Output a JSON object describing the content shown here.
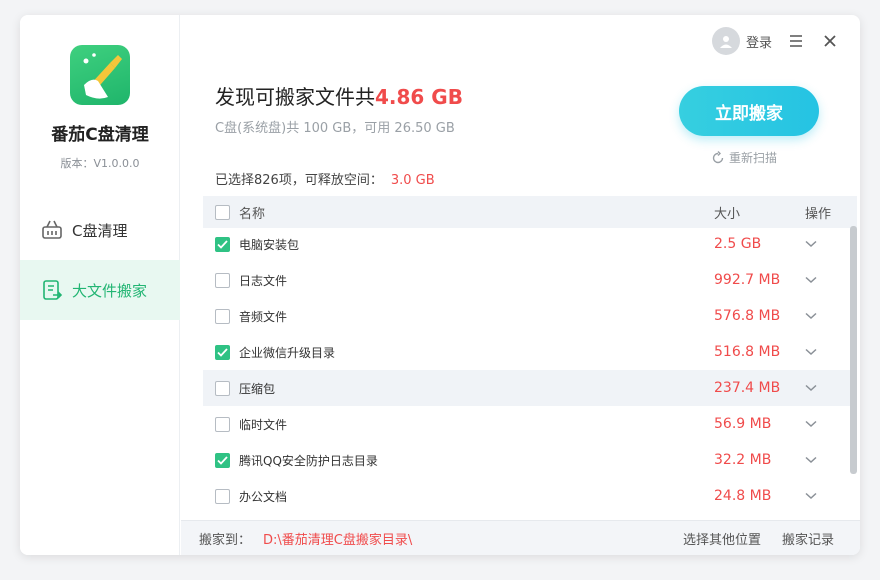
{
  "app": {
    "name": "番茄C盘清理",
    "version": "版本：V1.0.0.0"
  },
  "sidebar": {
    "items": [
      {
        "label": "C盘清理",
        "icon": "basket-icon"
      },
      {
        "label": "大文件搬家",
        "icon": "file-move-icon"
      }
    ]
  },
  "topbar": {
    "login": "登录"
  },
  "summary": {
    "title_prefix": "发现可搬家文件共",
    "total_size": "4.86 GB",
    "disk_info": "C盘(系统盘)共 100 GB，可用 26.50 GB",
    "selected_text": "已选择826项，可释放空间：",
    "selected_size": "3.0 GB"
  },
  "actions": {
    "move_now": "立即搬家",
    "rescan": "重新扫描"
  },
  "table": {
    "headers": {
      "name": "名称",
      "size": "大小",
      "op": "操作"
    },
    "rows": [
      {
        "name": "电脑安装包",
        "size": "2.5 GB",
        "checked": true
      },
      {
        "name": "日志文件",
        "size": "992.7 MB",
        "checked": false
      },
      {
        "name": "音频文件",
        "size": "576.8 MB",
        "checked": false
      },
      {
        "name": "企业微信升级目录",
        "size": "516.8 MB",
        "checked": true
      },
      {
        "name": "压缩包",
        "size": "237.4 MB",
        "checked": false
      },
      {
        "name": "临时文件",
        "size": "56.9 MB",
        "checked": false
      },
      {
        "name": "腾讯QQ安全防护日志目录",
        "size": "32.2 MB",
        "checked": true
      },
      {
        "name": "办公文档",
        "size": "24.8 MB",
        "checked": false
      }
    ]
  },
  "footer": {
    "move_to_label": "搬家到：",
    "move_to_path": "D:\\番茄清理C盘搬家目录\\",
    "choose_other": "选择其他位置",
    "history": "搬家记录"
  },
  "colors": {
    "accent": "#22b573",
    "danger": "#f04b4b",
    "button": "#2ec9e1"
  }
}
